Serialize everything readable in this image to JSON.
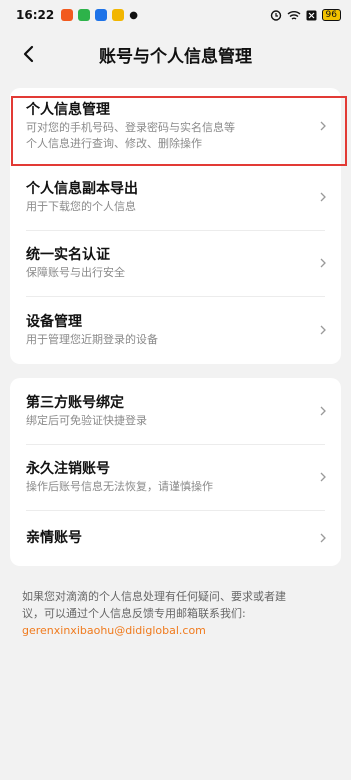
{
  "status_bar": {
    "time": "16:22",
    "battery": "96"
  },
  "nav": {
    "title": "账号与个人信息管理"
  },
  "section1": [
    {
      "title": "个人信息管理",
      "desc_lines": [
        "可对您的手机号码、登录密码与实名信息等",
        "个人信息进行查询、修改、删除操作"
      ]
    },
    {
      "title": "个人信息副本导出",
      "desc_lines": [
        "用于下载您的个人信息"
      ]
    },
    {
      "title": "统一实名认证",
      "desc_lines": [
        "保障账号与出行安全"
      ]
    },
    {
      "title": "设备管理",
      "desc_lines": [
        "用于管理您近期登录的设备"
      ]
    }
  ],
  "section2": [
    {
      "title": "第三方账号绑定",
      "desc_lines": [
        "绑定后可免验证快捷登录"
      ]
    },
    {
      "title": "永久注销账号",
      "desc_lines": [
        "操作后账号信息无法恢复，请谨慎操作"
      ]
    },
    {
      "title": "亲情账号",
      "desc_lines": []
    }
  ],
  "footer": {
    "line1": "如果您对滴滴的个人信息处理有任何疑问、要求或者建",
    "line2": "议，可以通过个人信息反馈专用邮箱联系我们:",
    "email": "gerenxinxibaohu@didiglobal.com"
  },
  "colors": {
    "accent": "#f07b1e",
    "highlight": "#e23a35"
  }
}
